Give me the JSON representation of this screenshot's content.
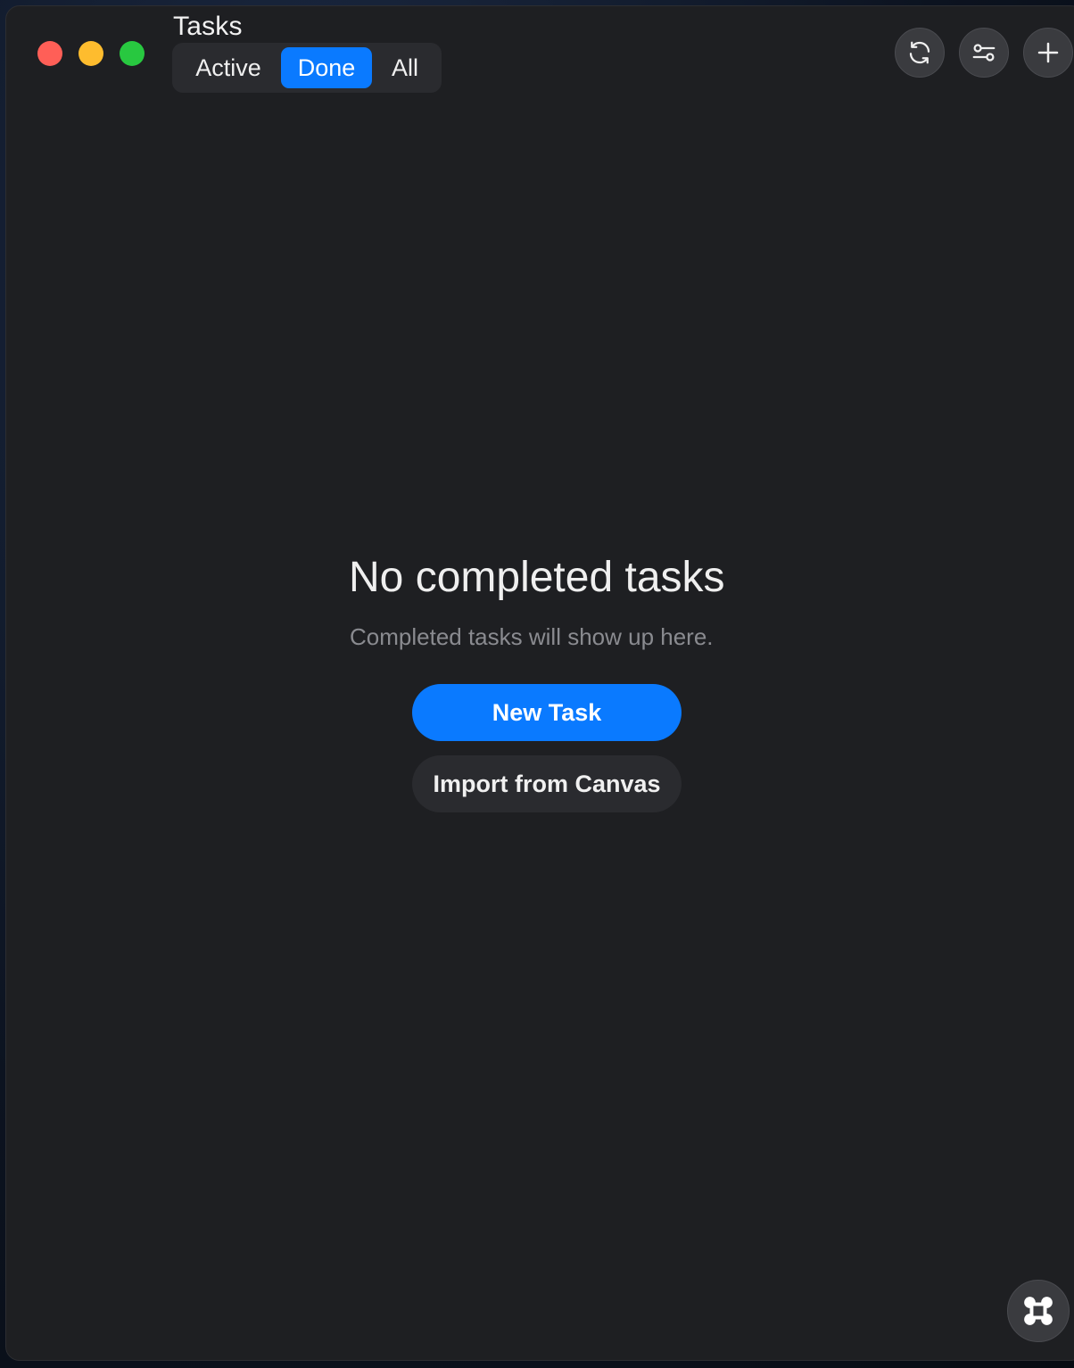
{
  "window": {
    "title": "Tasks"
  },
  "tabs": [
    {
      "label": "Active",
      "selected": false
    },
    {
      "label": "Done",
      "selected": true
    },
    {
      "label": "All",
      "selected": false
    }
  ],
  "toolbar": {
    "icons": [
      "refresh-icon",
      "filter-sliders-icon",
      "plus-icon"
    ]
  },
  "empty_state": {
    "title": "No completed tasks",
    "subtitle": "Completed tasks will show up here.",
    "primary_button": "New Task",
    "secondary_button": "Import from Canvas"
  },
  "corner_button": {
    "icon": "command-icon"
  },
  "colors": {
    "accent": "#0a7aff",
    "background": "#1e1f22",
    "traffic_red": "#ff5f57",
    "traffic_yellow": "#febc2e",
    "traffic_green": "#28c840"
  }
}
